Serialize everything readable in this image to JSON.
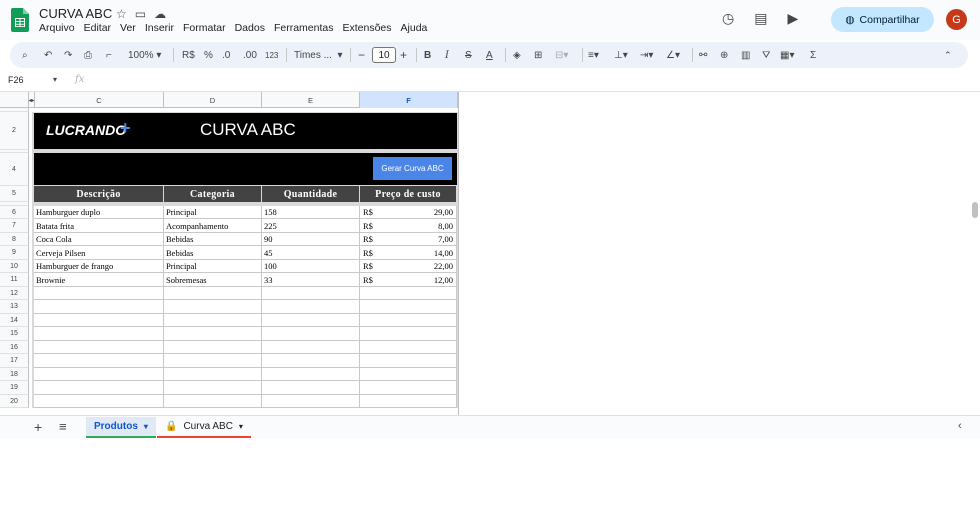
{
  "app": {
    "doc_title": "CURVA ABC",
    "menu": [
      "Arquivo",
      "Editar",
      "Ver",
      "Inserir",
      "Formatar",
      "Dados",
      "Ferramentas",
      "Extensões",
      "Ajuda"
    ],
    "share_label": "Compartilhar",
    "avatar_initial": "G"
  },
  "toolbar": {
    "zoom": "100%",
    "currency": "R$",
    "percent": "%",
    "dec_decrease": ".0",
    "dec_increase": ".00",
    "number_format": "123",
    "font": "Times ...",
    "font_size": "10",
    "bold": "B",
    "italic": "I",
    "strike": "S",
    "text_color": "A",
    "sum": "Σ"
  },
  "formula_bar": {
    "cell_ref": "F26",
    "fx": "fx"
  },
  "columns": [
    "C",
    "D",
    "E",
    "F"
  ],
  "rows": [
    "2",
    "4",
    "5",
    "6",
    "7",
    "8",
    "9",
    "10",
    "11",
    "12",
    "13",
    "14",
    "15",
    "16",
    "17",
    "18",
    "19",
    "20"
  ],
  "sheet": {
    "brand": "LUCRANDO",
    "brand_plus": "+",
    "title": "CURVA ABC",
    "button": "Gerar Curva ABC",
    "headers": [
      "Descrição",
      "Categoria",
      "Quantidade",
      "Preço de custo"
    ],
    "currency_symbol": "R$",
    "items": [
      {
        "desc": "Hamburguer duplo",
        "cat": "Principal",
        "qty": "158",
        "price": "29,00"
      },
      {
        "desc": "Batata frita",
        "cat": "Acompanhamento",
        "qty": "225",
        "price": "8,00"
      },
      {
        "desc": "Coca Cola",
        "cat": "Bebidas",
        "qty": "90",
        "price": "7,00"
      },
      {
        "desc": "Cerveja Pilsen",
        "cat": "Bebidas",
        "qty": "45",
        "price": "14,00"
      },
      {
        "desc": "Hamburguer de frango",
        "cat": "Principal",
        "qty": "100",
        "price": "22,00"
      },
      {
        "desc": "Brownie",
        "cat": "Sobremesas",
        "qty": "33",
        "price": "12,00"
      }
    ]
  },
  "tabs": {
    "produtos": "Produtos",
    "curva": "Curva ABC"
  },
  "colors": {
    "accent": "#0b57d0",
    "share_bg": "#c2e7ff",
    "button_blue": "#4a86e8",
    "header_dark": "#434343",
    "avatar_bg": "#c5391a"
  }
}
